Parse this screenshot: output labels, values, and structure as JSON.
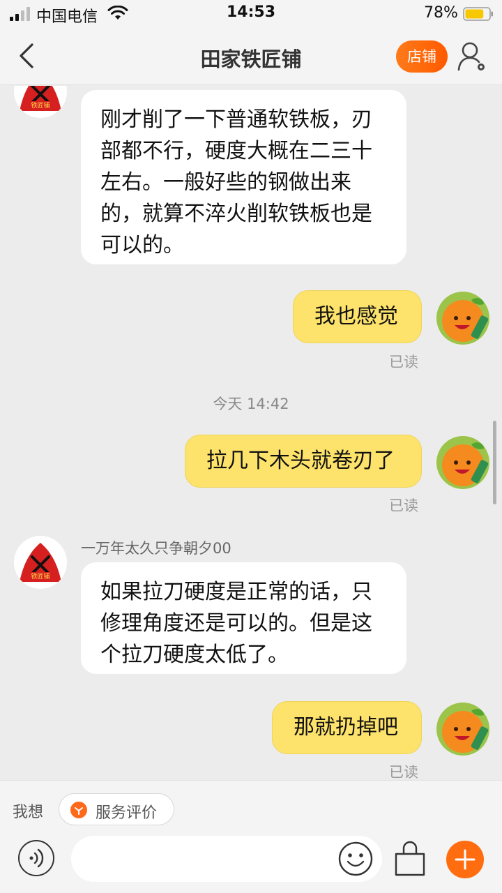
{
  "status_bar": {
    "carrier": "中国电信",
    "time": "14:53",
    "battery_percent": "78%",
    "battery_level": 0.78
  },
  "header": {
    "title": "田家铁匠铺",
    "shop_button": "店铺",
    "back_icon": "chevron-left-icon",
    "profile_icon": "user-settings-icon"
  },
  "shop_avatar_text": "铁匠铺",
  "messages": [
    {
      "side": "left",
      "text": "刚才削了一下普通软铁板，刃部都不行，硬度大概在二三十左右。一般好些的钢做出来的，就算不淬火削软铁板也是可以的。"
    },
    {
      "side": "right",
      "text": "我也感觉",
      "status": "已读"
    },
    {
      "type": "time",
      "text": "今天 14:42"
    },
    {
      "side": "right",
      "text": "拉几下木头就卷刃了",
      "status": "已读"
    },
    {
      "side": "left",
      "sender": "一万年太久只争朝夕00",
      "text": "如果拉刀硬度是正常的话，只修理角度还是可以的。但是这个拉刀硬度太低了。"
    },
    {
      "side": "right",
      "text": "那就扔掉吧",
      "status": "已读"
    }
  ],
  "quick_bar": {
    "label": "我想",
    "service_chip": "服务评价"
  },
  "input": {
    "placeholder": ""
  },
  "colors": {
    "accent": "#ff6d10",
    "bubble_self": "#fde36b",
    "bubble_other": "#ffffff",
    "background": "#ececec"
  }
}
